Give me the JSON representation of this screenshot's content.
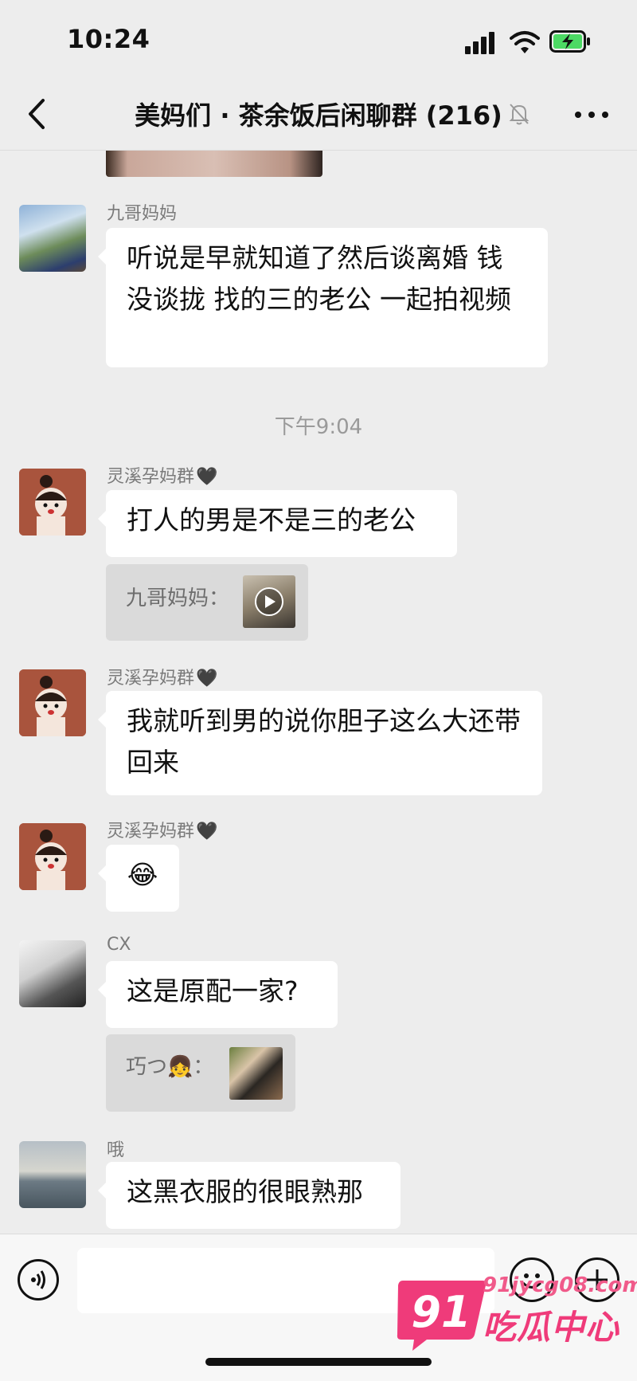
{
  "status_bar": {
    "time": "10:24"
  },
  "header": {
    "title": "美妈们 · 茶余饭后闲聊群 (216)"
  },
  "icons": {
    "back": "chevron-left-icon",
    "mute": "bell-slash-icon",
    "more": "ellipsis-icon",
    "voice": "voice-icon",
    "emoji": "emoji-face-icon",
    "plus": "plus-icon"
  },
  "messages": [
    {
      "sender": "九哥妈妈",
      "text": "听说是早就知道了然后谈离婚 钱没谈拢 找的三的老公 一起拍视频"
    },
    {
      "sender": "灵溪孕妈群",
      "sender_emoji": "🖤",
      "text": "打人的男是不是三的老公",
      "quote": {
        "text": "九哥妈妈：",
        "type": "video"
      }
    },
    {
      "sender": "灵溪孕妈群",
      "sender_emoji": "🖤",
      "text": "我就听到男的说你胆子这么大还带回来"
    },
    {
      "sender": "灵溪孕妈群",
      "sender_emoji": "🖤",
      "text": "😂"
    },
    {
      "sender": "CX",
      "text": "这是原配一家?",
      "quote": {
        "text": "巧つ👧：",
        "type": "image"
      }
    },
    {
      "sender": "哦",
      "text": "这黑衣服的很眼熟那"
    }
  ],
  "timestamp": "下午9:04",
  "input": {
    "value": ""
  },
  "watermark": {
    "badge": "91",
    "domain": "91jycg08.com",
    "name": "吃瓜中心"
  }
}
